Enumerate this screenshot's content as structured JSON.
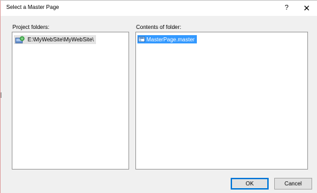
{
  "window": {
    "title": "Select a Master Page",
    "help_label": "?",
    "close_label": "✕"
  },
  "project_folders": {
    "label": "Project folders:",
    "items": [
      {
        "label": "E:\\MyWebSite\\MyWebSite\\",
        "icon": "web-folder-icon",
        "selected": true
      }
    ]
  },
  "contents": {
    "label": "Contents of folder:",
    "items": [
      {
        "label": "MasterPage.master",
        "icon": "master-file-icon",
        "selected": true
      }
    ]
  },
  "buttons": {
    "ok_label": "OK",
    "cancel_label": "Cancel"
  },
  "colors": {
    "selection": "#3399ff",
    "tree_highlight": "#e4e4e4",
    "dialog_bg": "#f0f0f0",
    "default_button_border": "#0078d7"
  }
}
